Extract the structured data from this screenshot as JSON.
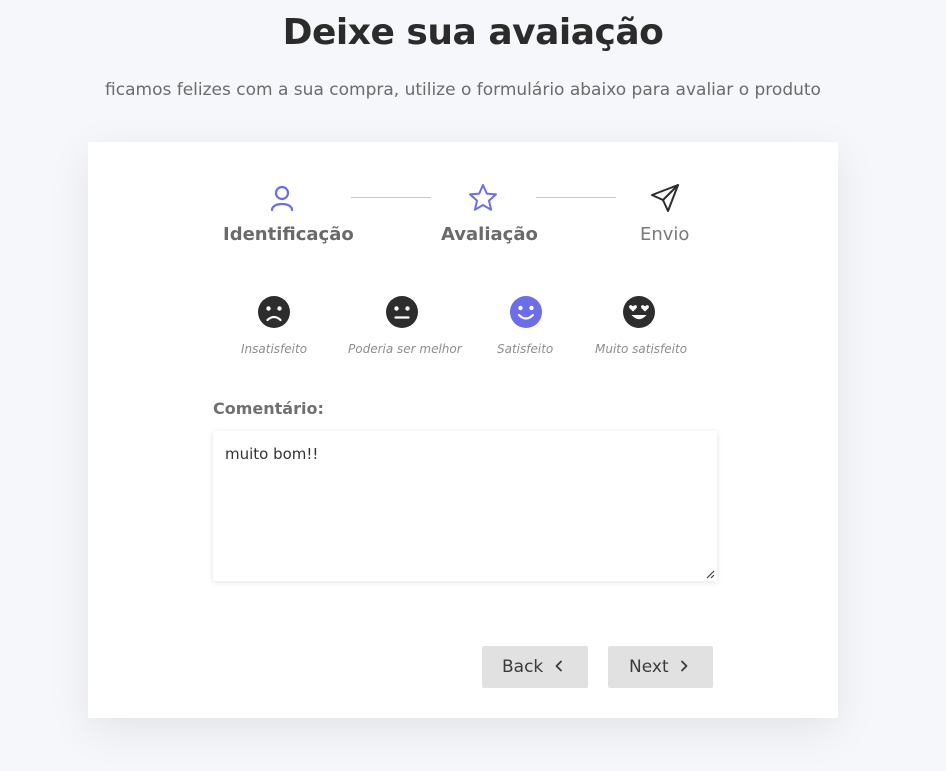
{
  "header": {
    "title": "Deixe sua avaiação",
    "subtitle": "ficamos felizes com a sua compra, utilize o formulário abaixo para avaliar o produto"
  },
  "steps": [
    {
      "label": "Identificação",
      "icon": "user-icon",
      "state": "completed"
    },
    {
      "label": "Avaliação",
      "icon": "star-icon",
      "state": "active"
    },
    {
      "label": "Envio",
      "icon": "send-icon",
      "state": "pending"
    }
  ],
  "ratings": [
    {
      "label": "Insatisfeito",
      "icon": "frown-face-icon",
      "selected": false
    },
    {
      "label": "Poderia ser melhor",
      "icon": "neutral-face-icon",
      "selected": false
    },
    {
      "label": "Satisfeito",
      "icon": "smile-face-icon",
      "selected": true
    },
    {
      "label": "Muito satisfeito",
      "icon": "heart-eyes-face-icon",
      "selected": false
    }
  ],
  "comment": {
    "label": "Comentário:",
    "value": "muito bom!!"
  },
  "buttons": {
    "back": "Back",
    "next": "Next"
  },
  "colors": {
    "accent": "#6b6ee8",
    "inactive_icon": "#2d2d2d",
    "button_bg": "#e1e1e1",
    "page_bg": "#f6f7fb"
  }
}
